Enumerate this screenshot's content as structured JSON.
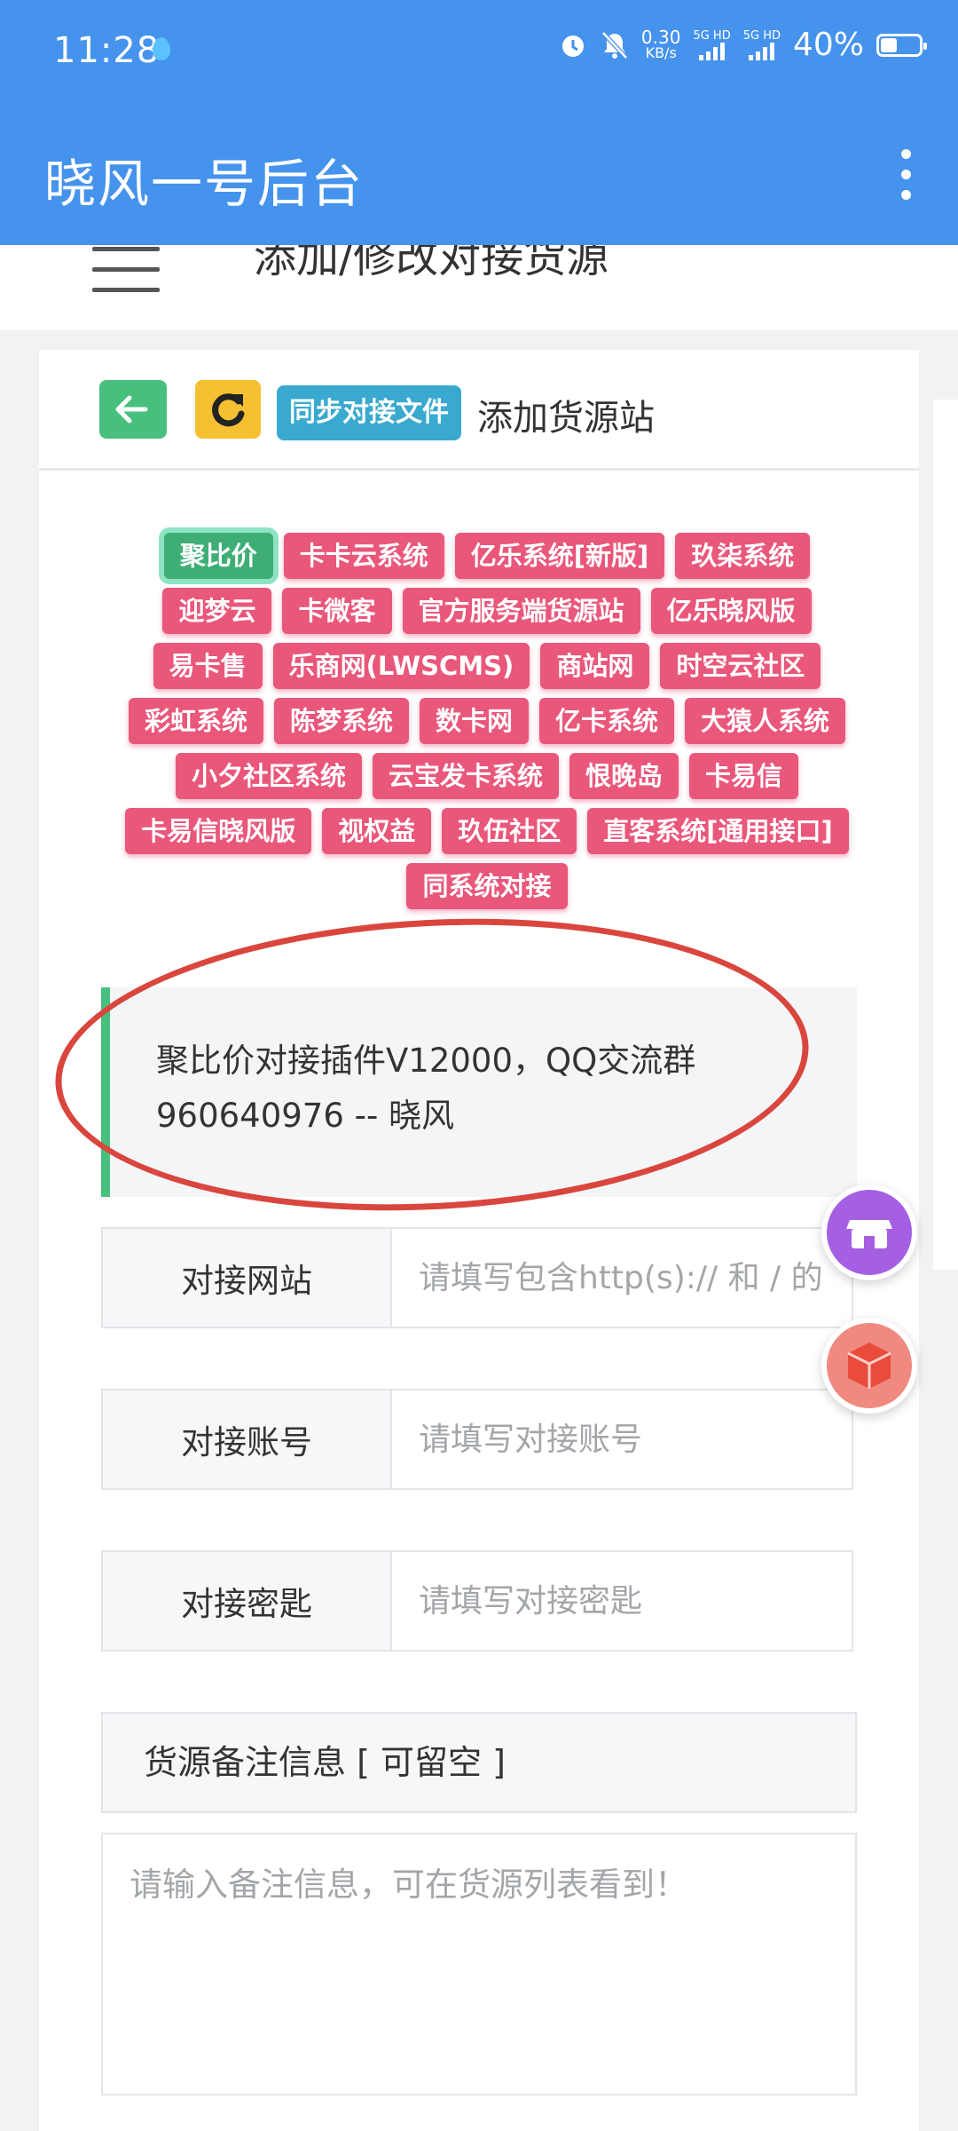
{
  "status_bar": {
    "time": "11:28",
    "net_speed_value": "0.30",
    "net_speed_unit": "KB/s",
    "sim1_label": "5G HD",
    "sim2_label": "5G HD",
    "battery_percent": "40%",
    "battery_level": 0.4,
    "icons": [
      "alarm-icon",
      "mute-icon",
      "signal-icon",
      "battery-icon"
    ]
  },
  "app_bar": {
    "title": "晓风一号后台",
    "menu_icon": "more-vertical-icon"
  },
  "page": {
    "title": "添加/修改对接货源"
  },
  "card_header": {
    "back_icon": "arrow-left-icon",
    "refresh_icon": "refresh-icon",
    "sync_label": "同步对接文件",
    "heading": "添加货源站"
  },
  "source_types": [
    {
      "label": "聚比价",
      "active": true
    },
    {
      "label": "卡卡云系统"
    },
    {
      "label": "亿乐系统[新版]"
    },
    {
      "label": "玖柒系统"
    },
    {
      "label": "迎梦云"
    },
    {
      "label": "卡微客"
    },
    {
      "label": "官方服务端货源站"
    },
    {
      "label": "亿乐晓风版"
    },
    {
      "label": "易卡售"
    },
    {
      "label": "乐商网(LWSCMS)"
    },
    {
      "label": "商站网"
    },
    {
      "label": "时空云社区"
    },
    {
      "label": "彩虹系统"
    },
    {
      "label": "陈梦系统"
    },
    {
      "label": "数卡网"
    },
    {
      "label": "亿卡系统"
    },
    {
      "label": "大猿人系统"
    },
    {
      "label": "小夕社区系统"
    },
    {
      "label": "云宝发卡系统"
    },
    {
      "label": "恨晚岛"
    },
    {
      "label": "卡易信"
    },
    {
      "label": "卡易信晓风版"
    },
    {
      "label": "视权益"
    },
    {
      "label": "玖伍社区"
    },
    {
      "label": "直客系统[通用接口]"
    },
    {
      "label": "同系统对接"
    }
  ],
  "notice": {
    "line1": "聚比价对接插件V12000，QQ交流群",
    "line2": "960640976 -- 晓风"
  },
  "form": {
    "site": {
      "label": "对接网站",
      "placeholder": "请填写包含http(s):// 和 / 的",
      "value": ""
    },
    "account": {
      "label": "对接账号",
      "placeholder": "请填写对接账号",
      "value": ""
    },
    "key": {
      "label": "对接密匙",
      "placeholder": "请填写对接密匙",
      "value": ""
    },
    "notes": {
      "label": "货源备注信息 [ 可留空 ]",
      "placeholder": "请输入备注信息，可在货源列表看到！",
      "value": ""
    }
  },
  "floating_buttons": [
    {
      "name": "shop-icon",
      "color": "#a45fe3"
    },
    {
      "name": "cube-icon",
      "color": "#f08a80"
    }
  ],
  "colors": {
    "primary": "#4593ec",
    "tag": "#e9577a",
    "active_tag": "#3fae75",
    "success": "#47c07e",
    "warning": "#f6c033",
    "info": "#3aa9cf",
    "annotation": "#d9463e"
  }
}
